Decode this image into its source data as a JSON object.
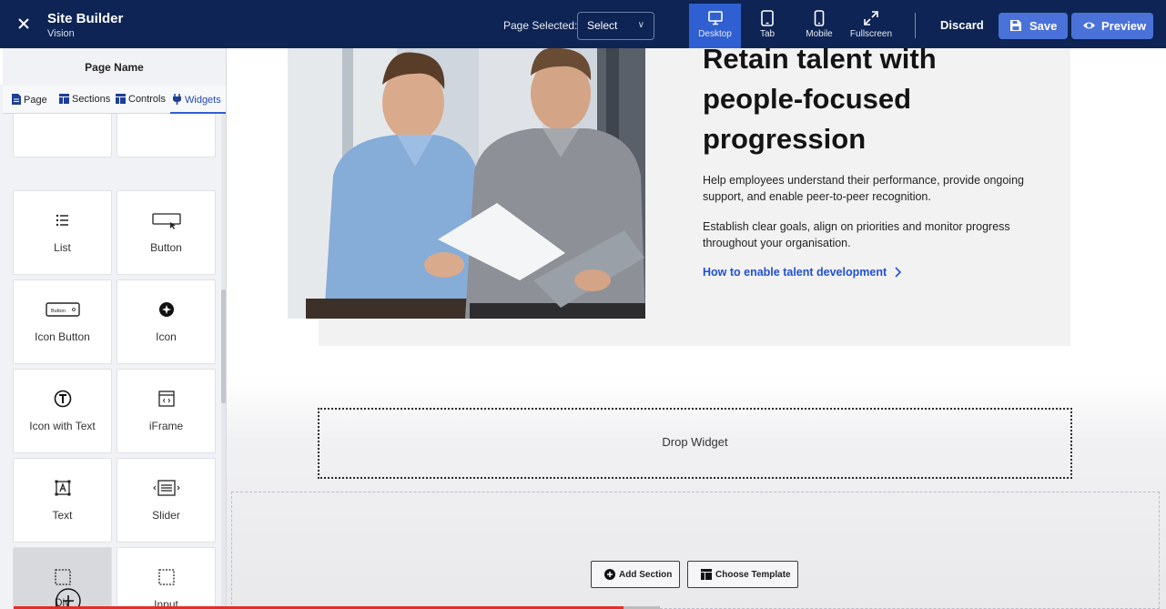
{
  "app": {
    "title": "Site Builder",
    "subtitle": "Vision"
  },
  "toolbar": {
    "page_selected_label": "Page Selected:",
    "page_select_value": "Select",
    "devices": [
      {
        "label": "Desktop",
        "icon": "monitor-icon",
        "active": true
      },
      {
        "label": "Tab",
        "icon": "tablet-icon",
        "active": false
      },
      {
        "label": "Mobile",
        "icon": "mobile-icon",
        "active": false
      },
      {
        "label": "Fullscreen",
        "icon": "fullscreen-icon",
        "active": false
      }
    ],
    "discard_label": "Discard",
    "save_label": "Save",
    "preview_label": "Preview"
  },
  "panel": {
    "title": "Page Name",
    "tabs": [
      {
        "label": "Page",
        "icon": "document-icon"
      },
      {
        "label": "Sections",
        "icon": "layout-icon"
      },
      {
        "label": "Controls",
        "icon": "layout-icon"
      },
      {
        "label": "Widgets",
        "icon": "plug-icon",
        "active": true
      }
    ],
    "widgets": [
      {
        "label": "List",
        "icon": "list-icon"
      },
      {
        "label": "Button",
        "icon": "button-icon"
      },
      {
        "label": "Icon Button",
        "icon": "icon-button-icon",
        "inner_text": "Button"
      },
      {
        "label": "Icon",
        "icon": "icon-icon"
      },
      {
        "label": "Icon with Text",
        "icon": "text-circle-icon"
      },
      {
        "label": "iFrame",
        "icon": "iframe-icon"
      },
      {
        "label": "Text",
        "icon": "text-box-icon"
      },
      {
        "label": "Slider",
        "icon": "slider-icon"
      },
      {
        "label": "Div",
        "icon": "div-icon"
      },
      {
        "label": "Input",
        "icon": "input-icon"
      }
    ]
  },
  "canvas": {
    "headline": "Retain talent with people-focused progression",
    "paragraph1": "Help employees understand their performance, provide ongoing support, and enable peer-to-peer recognition.",
    "paragraph2": "Establish clear goals, align on priorities and monitor progress throughout your organisation.",
    "link_text": "How to enable talent development",
    "drop_widget": "Drop Widget",
    "add_section": "Add Section",
    "choose_template": "Choose Template"
  },
  "colors": {
    "topbar": "#0d2454",
    "accent": "#2f5fd1",
    "button": "#4a72d8",
    "link": "#2150d6"
  }
}
